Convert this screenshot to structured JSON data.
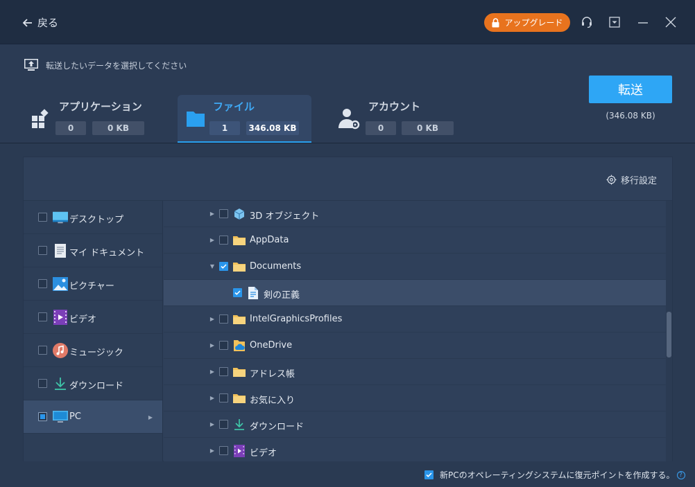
{
  "titlebar": {
    "back_label": "戻る",
    "upgrade_label": "アップグレード",
    "icons": [
      "headset-icon",
      "dropdown-icon",
      "minimize-icon",
      "close-icon"
    ]
  },
  "header": {
    "hint": "転送したいデータを選択してください",
    "categories": [
      {
        "title": "アプリケーション",
        "count": "0",
        "size": "0 KB",
        "icon": "apps-icon",
        "active": false
      },
      {
        "title": "ファイル",
        "count": "1",
        "size": "346.08 KB",
        "icon": "folder-icon",
        "active": true
      },
      {
        "title": "アカウント",
        "count": "0",
        "size": "0 KB",
        "icon": "account-settings-icon",
        "active": false
      }
    ],
    "transfer_label": "転送",
    "transfer_size": "(346.08 KB)"
  },
  "panel": {
    "settings_label": "移行設定",
    "sidebar": [
      {
        "label": "デスクトップ",
        "icon": "desktop-icon",
        "checked": false
      },
      {
        "label": "マイ ドキュメント",
        "icon": "document-icon",
        "checked": false
      },
      {
        "label": "ピクチャー",
        "icon": "picture-icon",
        "checked": false
      },
      {
        "label": "ビデオ",
        "icon": "video-icon",
        "checked": false
      },
      {
        "label": "ミュージック",
        "icon": "music-icon",
        "checked": false
      },
      {
        "label": "ダウンロード",
        "icon": "download-icon",
        "checked": false
      },
      {
        "label": "PC",
        "icon": "pc-icon",
        "checked": "partial"
      }
    ],
    "tree": [
      {
        "label": "3D オブジェクト",
        "icon": "cube-icon",
        "checked": false,
        "expanded": false
      },
      {
        "label": "AppData",
        "icon": "folder-icon",
        "checked": false,
        "expanded": false
      },
      {
        "label": "Documents",
        "icon": "folder-icon",
        "checked": true,
        "expanded": true
      },
      {
        "label": "剣の正義",
        "icon": "file-doc-icon",
        "checked": true,
        "child": true,
        "selected": true
      },
      {
        "label": "IntelGraphicsProfiles",
        "icon": "folder-icon",
        "checked": false,
        "expanded": false
      },
      {
        "label": "OneDrive",
        "icon": "onedrive-icon",
        "checked": false,
        "expanded": false
      },
      {
        "label": "アドレス帳",
        "icon": "folder-icon",
        "checked": false,
        "expanded": false
      },
      {
        "label": "お気に入り",
        "icon": "folder-icon",
        "checked": false,
        "expanded": false
      },
      {
        "label": "ダウンロード",
        "icon": "download-icon",
        "checked": false,
        "expanded": false
      },
      {
        "label": "ビデオ",
        "icon": "video-icon",
        "checked": false,
        "expanded": false
      }
    ]
  },
  "footer": {
    "restore_point_label": "新PCのオペレーティングシステムに復元ポイントを作成する。",
    "restore_point_checked": true,
    "help_glyph": "?"
  },
  "colors": {
    "accent": "#2ea6f5",
    "upgrade": "#e8731e",
    "titlebar": "#1f2d42",
    "background": "#2a3a52"
  }
}
